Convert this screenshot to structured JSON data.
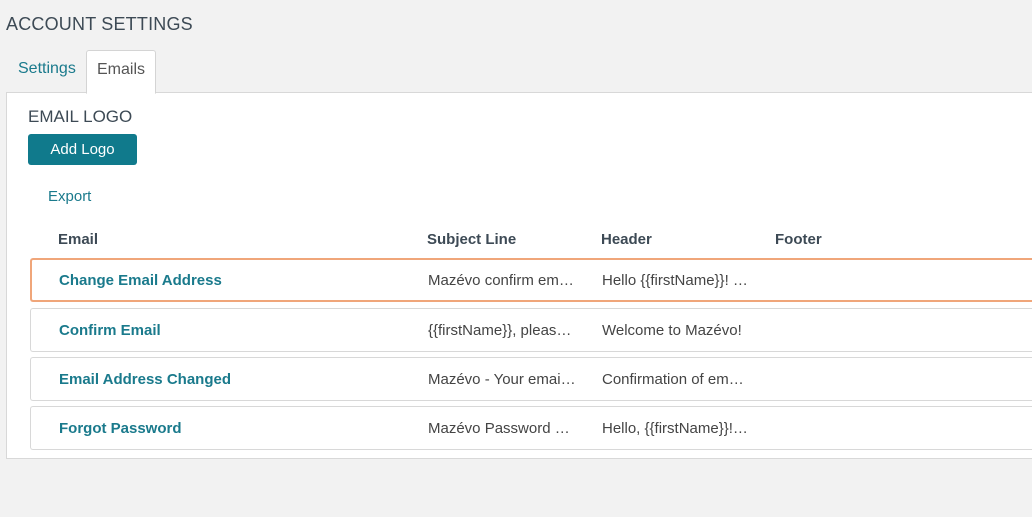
{
  "page": {
    "title": "ACCOUNT SETTINGS"
  },
  "tabs": [
    {
      "label": "Settings",
      "active": false
    },
    {
      "label": "Emails",
      "active": true
    }
  ],
  "email_logo": {
    "title": "EMAIL LOGO",
    "add_button_label": "Add Logo"
  },
  "export_label": "Export",
  "table": {
    "columns": [
      "Email",
      "Subject Line",
      "Header",
      "Footer"
    ],
    "rows": [
      {
        "name": "Change Email Address",
        "subject": "Mazévo confirm email address",
        "header": "Hello {{firstName}}! Please",
        "footer": "",
        "selected": true
      },
      {
        "name": "Confirm Email",
        "subject": "{{firstName}}, please confirm",
        "header": "Welcome to Mazévo!",
        "footer": "",
        "selected": false
      },
      {
        "name": "Email Address Changed",
        "subject": "Mazévo - Your email address",
        "header": "Confirmation of email change",
        "footer": "",
        "selected": false
      },
      {
        "name": "Forgot Password",
        "subject": "Mazévo Password Reset",
        "header": "Hello, {{firstName}}! We",
        "footer": "",
        "selected": false
      }
    ]
  },
  "colors": {
    "accent": "#107a8c",
    "selected_border": "#f0a67a"
  }
}
